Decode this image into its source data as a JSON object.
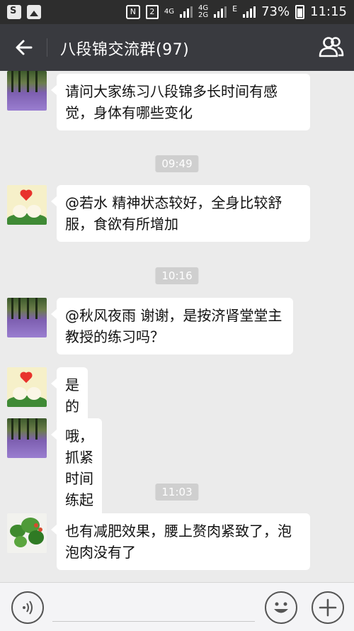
{
  "status_bar": {
    "battery_percent": "73%",
    "time": "11:15",
    "network_a": "4G",
    "network_b": "4G",
    "network_b2": "2G",
    "data_type": "E",
    "sim_number": "2"
  },
  "header": {
    "title": "八段锦交流群(97)"
  },
  "messages": [
    {
      "type": "text",
      "avatar": "lavender-field",
      "text": "请问大家练习八段锦多长时间有感觉，身体有哪些变化"
    },
    {
      "type": "time",
      "text": "09:49"
    },
    {
      "type": "text",
      "avatar": "cute-couple",
      "text": "@若水 精神状态较好，全身比较舒服，食欲有所增加"
    },
    {
      "type": "time",
      "text": "10:16"
    },
    {
      "type": "text",
      "avatar": "lavender-field",
      "text": "@秋风夜雨 谢谢，是按济肾堂堂主教授的练习吗？"
    },
    {
      "type": "text",
      "avatar": "cute-couple",
      "text": "是的"
    },
    {
      "type": "text",
      "avatar": "lavender-field",
      "text": "哦，抓紧时间练起来"
    },
    {
      "type": "time",
      "text": "11:03"
    },
    {
      "type": "text",
      "avatar": "potted-plant",
      "text": "也有减肥效果，腰上赘肉紧致了，泡泡肉没有了"
    }
  ],
  "input_bar": {
    "icons": [
      "voice-icon",
      "emoji-icon",
      "plus-icon"
    ]
  }
}
